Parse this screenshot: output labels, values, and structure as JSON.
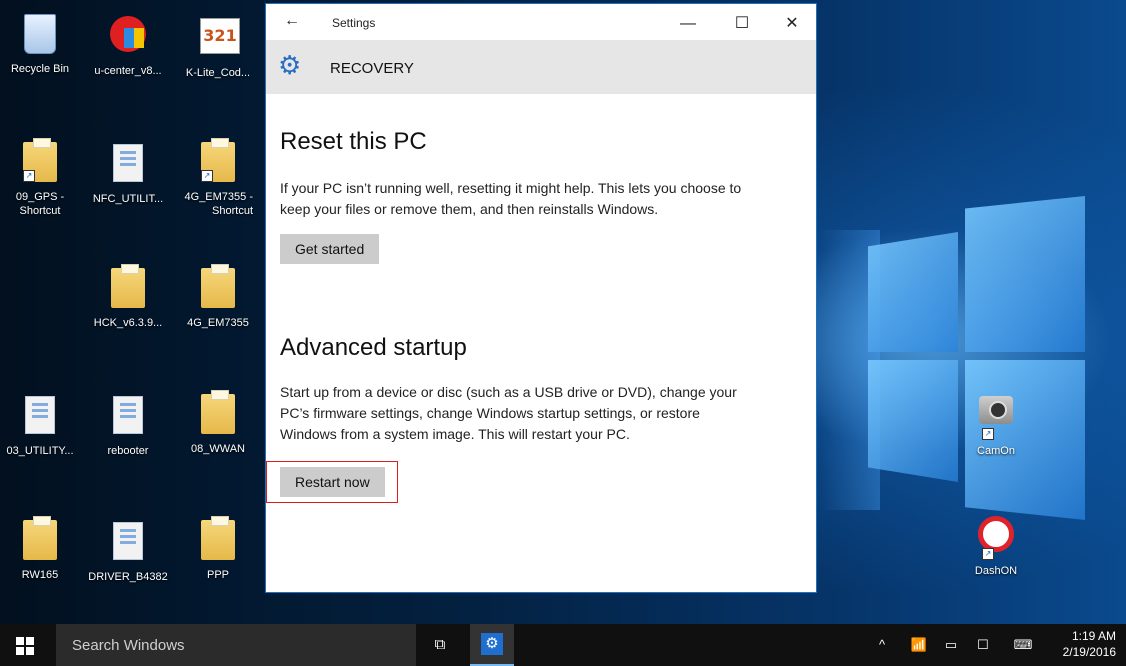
{
  "desktop": {
    "icons": [
      {
        "label": "Recycle Bin"
      },
      {
        "label": "u-center_v8..."
      },
      {
        "label": "K-Lite_Cod..."
      },
      {
        "label": "09_GPS - Shortcut"
      },
      {
        "label": "NFC_UTILIT..."
      },
      {
        "label": "4G_EM7355 - Shortcut"
      },
      {
        "label": "HCK_v6.3.9..."
      },
      {
        "label": "4G_EM7355"
      },
      {
        "label": "03_UTILITY..."
      },
      {
        "label": "rebooter"
      },
      {
        "label": "08_WWAN"
      },
      {
        "label": "RW165"
      },
      {
        "label": "DRIVER_B4382"
      },
      {
        "label": "PPP"
      },
      {
        "label": "CamOn"
      },
      {
        "label": "DashON"
      }
    ],
    "klite_badge": "321"
  },
  "window": {
    "title": "Settings",
    "back_icon": "←",
    "minimize_icon": "—",
    "maximize_icon": "☐",
    "close_icon": "✕",
    "header_title": "RECOVERY"
  },
  "reset": {
    "heading": "Reset this PC",
    "description": "If your PC isn’t running well, resetting it might help. This lets you choose to keep your files or remove them, and then reinstalls Windows.",
    "button": "Get started"
  },
  "advanced": {
    "heading": "Advanced startup",
    "description": "Start up from a device or disc (such as a USB drive or DVD), change your PC’s firmware settings, change Windows startup settings, or restore Windows from a system image. This will restart your PC.",
    "button": "Restart now",
    "highlight_color": "#d81e1e"
  },
  "taskbar": {
    "search_placeholder": "Search Windows",
    "time": "1:19 AM",
    "date": "2/19/2016"
  },
  "colors": {
    "accent": "#1f6fd0",
    "window_border": "#1a72c4",
    "button_bg": "#cccccc",
    "taskbar_bg": "#101010"
  }
}
